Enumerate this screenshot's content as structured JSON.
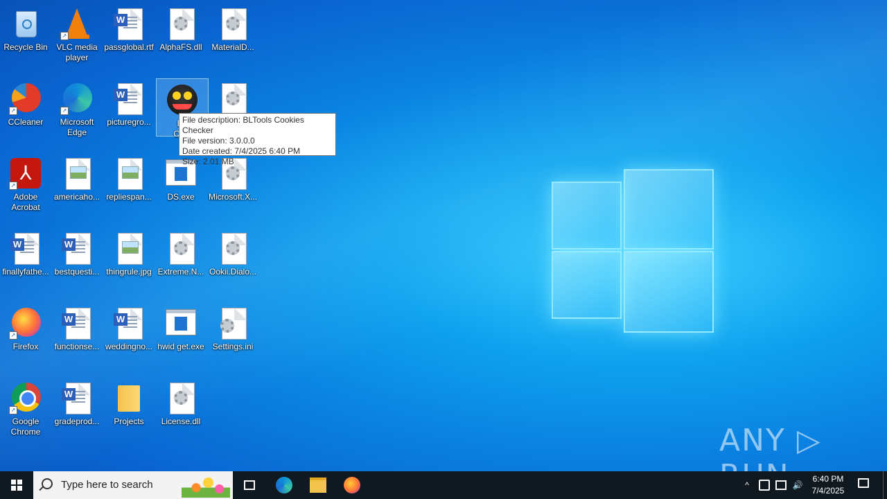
{
  "desktop_icons": [
    {
      "label": "Recycle Bin",
      "icon": "recycle-bin-icon"
    },
    {
      "label": "VLC media player",
      "icon": "vlc-icon"
    },
    {
      "label": "passglobal.rtf",
      "icon": "word-document-icon"
    },
    {
      "label": "AlphaFS.dll",
      "icon": "dll-file-icon"
    },
    {
      "label": "MaterialD...",
      "icon": "dll-file-icon"
    },
    {
      "label": "CCleaner",
      "icon": "ccleaner-icon"
    },
    {
      "label": "Microsoft Edge",
      "icon": "edge-icon"
    },
    {
      "label": "picturegro...",
      "icon": "word-document-icon"
    },
    {
      "label": "BLTools Crack",
      "icon": "bltools-icon"
    },
    {
      "label": "",
      "icon": "dll-file-icon"
    },
    {
      "label": "Adobe Acrobat",
      "icon": "acrobat-icon"
    },
    {
      "label": "americaho...",
      "icon": "image-file-icon"
    },
    {
      "label": "repliespan...",
      "icon": "image-file-icon"
    },
    {
      "label": "DS.exe",
      "icon": "exe-file-icon"
    },
    {
      "label": "Microsoft.X...",
      "icon": "dll-file-icon"
    },
    {
      "label": "finallyfathe...",
      "icon": "word-document-icon"
    },
    {
      "label": "bestquesti...",
      "icon": "word-document-icon"
    },
    {
      "label": "thingrule.jpg",
      "icon": "image-file-icon"
    },
    {
      "label": "Extreme.N...",
      "icon": "dll-file-icon"
    },
    {
      "label": "Ookii.Dialo...",
      "icon": "dll-file-icon"
    },
    {
      "label": "Firefox",
      "icon": "firefox-icon"
    },
    {
      "label": "functionse...",
      "icon": "word-document-icon"
    },
    {
      "label": "weddingno...",
      "icon": "word-document-icon"
    },
    {
      "label": "hwid get.exe",
      "icon": "exe-file-icon"
    },
    {
      "label": "Settings.ini",
      "icon": "settings-file-icon"
    },
    {
      "label": "Google Chrome",
      "icon": "chrome-icon"
    },
    {
      "label": "gradeprod...",
      "icon": "word-document-icon"
    },
    {
      "label": "Projects",
      "icon": "folder-icon"
    },
    {
      "label": "License.dll",
      "icon": "dll-file-icon"
    }
  ],
  "tooltip": {
    "line1": "File description: BLTools Cookies Checker",
    "line2": "File version: 3.0.0.0",
    "line3": "Date created: 7/4/2025 6:40 PM",
    "line4": "Size: 2.01 MB"
  },
  "selected_label_visible": "BL",
  "selected_label_visible2": "Crak",
  "watermark": "ANY ▷ RUN",
  "taskbar": {
    "search_placeholder": "Type here to search",
    "time": "6:40 PM",
    "date": "7/4/2025",
    "tray_chevron": "^"
  }
}
